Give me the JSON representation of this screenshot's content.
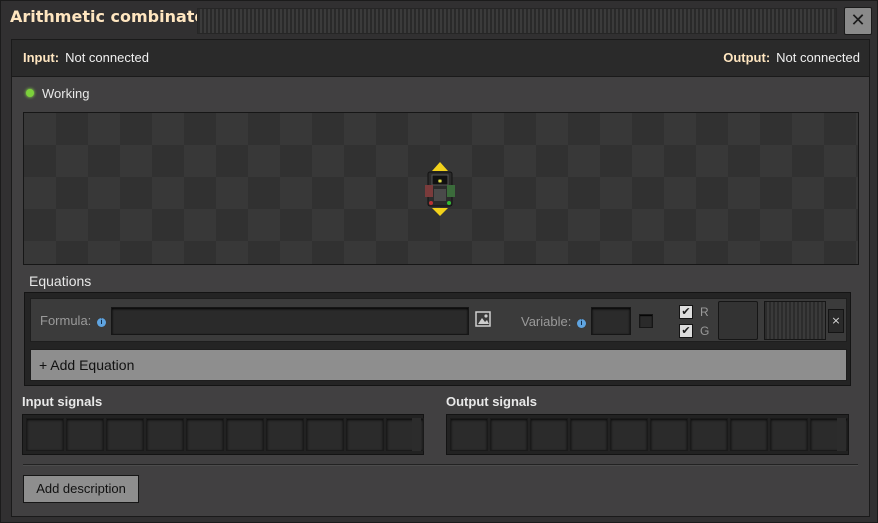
{
  "window": {
    "title": "Arithmetic combinator",
    "close_symbol": "✕"
  },
  "io": {
    "input_label": "Input:",
    "input_value": "Not connected",
    "output_label": "Output:",
    "output_value": "Not connected"
  },
  "status": {
    "text": "Working",
    "color": "#7cd13b"
  },
  "equations": {
    "header": "Equations",
    "formula_label": "Formula:",
    "formula_value": "",
    "variable_label": "Variable:",
    "info_symbol": "i",
    "checkboxes": [
      {
        "label": "R",
        "checked": true
      },
      {
        "label": "G",
        "checked": true
      }
    ],
    "remove_symbol": "×",
    "add_button": "+ Add Equation"
  },
  "signals": {
    "input_title": "Input signals",
    "output_title": "Output signals"
  },
  "footer": {
    "add_description": "Add description"
  },
  "icons": {
    "status": "status-light-icon",
    "entity": "arithmetic-combinator-icon",
    "image_picker": "image-picker-icon",
    "info": "info-icon",
    "checkbox": "checkmark-icon"
  }
}
